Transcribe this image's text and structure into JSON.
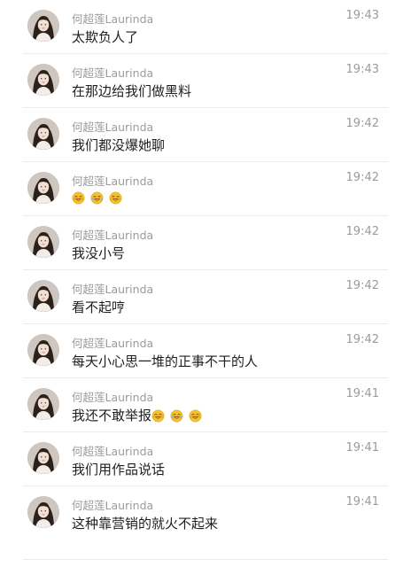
{
  "messages": [
    {
      "username": "何超莲Laurinda",
      "time": "19:43",
      "text": "太欺负人了",
      "emoji_count": 0
    },
    {
      "username": "何超莲Laurinda",
      "time": "19:43",
      "text": "在那边给我们做黑料",
      "emoji_count": 0
    },
    {
      "username": "何超莲Laurinda",
      "time": "19:42",
      "text": "我们都没爆她聊",
      "emoji_count": 0
    },
    {
      "username": "何超莲Laurinda",
      "time": "19:42",
      "text": "",
      "emoji_count": 3,
      "emoji": "laugh-cry-emoji"
    },
    {
      "username": "何超莲Laurinda",
      "time": "19:42",
      "text": "我没小号",
      "emoji_count": 0
    },
    {
      "username": "何超莲Laurinda",
      "time": "19:42",
      "text": "看不起哼",
      "emoji_count": 0
    },
    {
      "username": "何超莲Laurinda",
      "time": "19:42",
      "text": "每天小心思一堆的正事不干的人",
      "emoji_count": 0
    },
    {
      "username": "何超莲Laurinda",
      "time": "19:41",
      "text": "我还不敢举报",
      "emoji_count": 3,
      "emoji": "laugh-cry-emoji"
    },
    {
      "username": "何超莲Laurinda",
      "time": "19:41",
      "text": "我们用作品说话",
      "emoji_count": 0
    },
    {
      "username": "何超莲Laurinda",
      "time": "19:41",
      "text": "这种靠营销的就火不起来",
      "emoji_count": 0
    }
  ],
  "colors": {
    "background": "#ffffff",
    "username": "#9b9b9b",
    "time": "#9b9b9b",
    "text": "#1f1f1f",
    "divider": "#ececec",
    "emoji_face": "#f5c02b"
  }
}
